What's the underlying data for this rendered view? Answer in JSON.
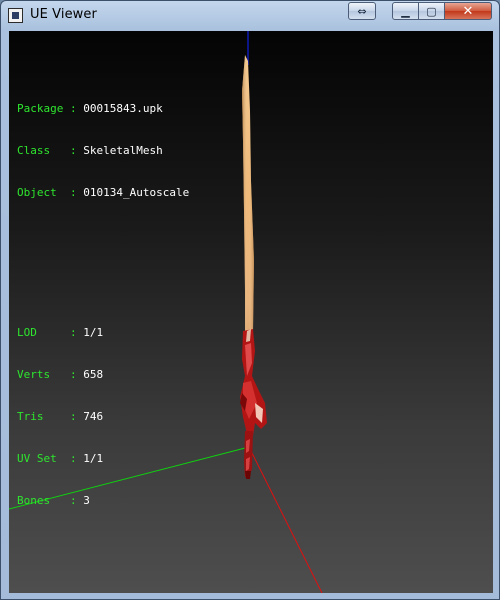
{
  "window": {
    "title": "UE Viewer",
    "controls": {
      "swap_glyph": "⇔",
      "minimize_glyph": "▁",
      "maximize_glyph": "▢",
      "close_glyph": "✕"
    }
  },
  "overlay": {
    "object_info": [
      {
        "key": "Package",
        "sep": ":",
        "value": "00015843.upk"
      },
      {
        "key": "Class  ",
        "sep": ":",
        "value": "SkeletalMesh"
      },
      {
        "key": "Object ",
        "sep": ":",
        "value": "010134_Autoscale"
      }
    ],
    "mesh_info": [
      {
        "key": "LOD    ",
        "sep": ":",
        "value": "1/1"
      },
      {
        "key": "Verts  ",
        "sep": ":",
        "value": "658"
      },
      {
        "key": "Tris   ",
        "sep": ":",
        "value": "746"
      },
      {
        "key": "UV Set ",
        "sep": ":",
        "value": "1/1"
      },
      {
        "key": "Bones  ",
        "sep": ":",
        "value": "3"
      }
    ]
  },
  "scene": {
    "axis_colors": {
      "x": "#e01010",
      "y": "#10d010",
      "z": "#1020e0"
    },
    "model": "sword-mesh"
  }
}
